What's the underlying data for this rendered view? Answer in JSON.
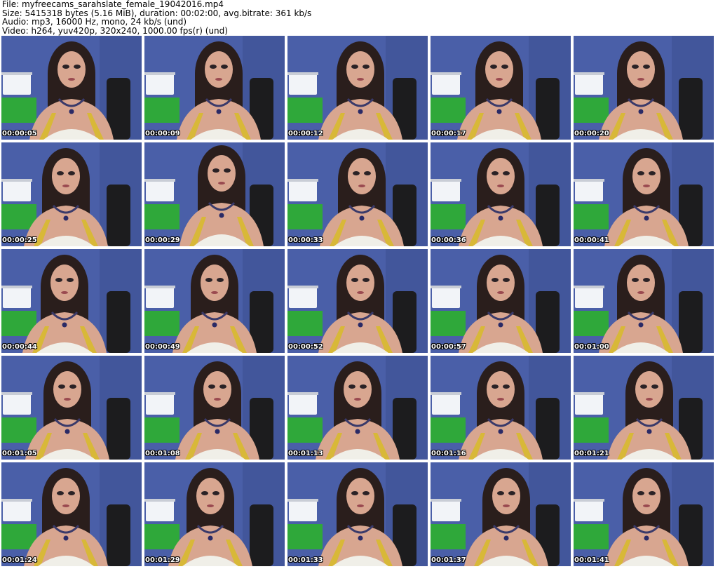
{
  "header": {
    "file_line": "File: myfreecams_sarahslate_female_19042016.mp4",
    "size_line": "Size: 5415318 bytes (5.16 MiB), duration: 00:02:00, avg.bitrate: 361 kb/s",
    "audio_line": "Audio: mp3, 16000 Hz, mono, 24 kb/s (und)",
    "video_line": "Video: h264, yuv420p, 320x240, 1000.00 fps(r) (und)"
  },
  "colors": {
    "wall": "#4a5fa8",
    "wall_dark": "#3a4b8c",
    "green_screen": "#2fa83a",
    "lamp": "#f2f4f8",
    "hair": "#2a1e1c",
    "skin": "#d8a690",
    "top": "#f0efe8",
    "strap": "#d8b838",
    "chair": "#1c1c1e"
  },
  "thumbnails": [
    {
      "timestamp": "00:00:05"
    },
    {
      "timestamp": "00:00:09"
    },
    {
      "timestamp": "00:00:12"
    },
    {
      "timestamp": "00:00:17"
    },
    {
      "timestamp": "00:00:20"
    },
    {
      "timestamp": "00:00:25"
    },
    {
      "timestamp": "00:00:29"
    },
    {
      "timestamp": "00:00:33"
    },
    {
      "timestamp": "00:00:36"
    },
    {
      "timestamp": "00:00:41"
    },
    {
      "timestamp": "00:00:44"
    },
    {
      "timestamp": "00:00:49"
    },
    {
      "timestamp": "00:00:52"
    },
    {
      "timestamp": "00:00:57"
    },
    {
      "timestamp": "00:01:00"
    },
    {
      "timestamp": "00:01:05"
    },
    {
      "timestamp": "00:01:08"
    },
    {
      "timestamp": "00:01:13"
    },
    {
      "timestamp": "00:01:16"
    },
    {
      "timestamp": "00:01:21"
    },
    {
      "timestamp": "00:01:24"
    },
    {
      "timestamp": "00:01:29"
    },
    {
      "timestamp": "00:01:33"
    },
    {
      "timestamp": "00:01:37"
    },
    {
      "timestamp": "00:01:41"
    }
  ]
}
